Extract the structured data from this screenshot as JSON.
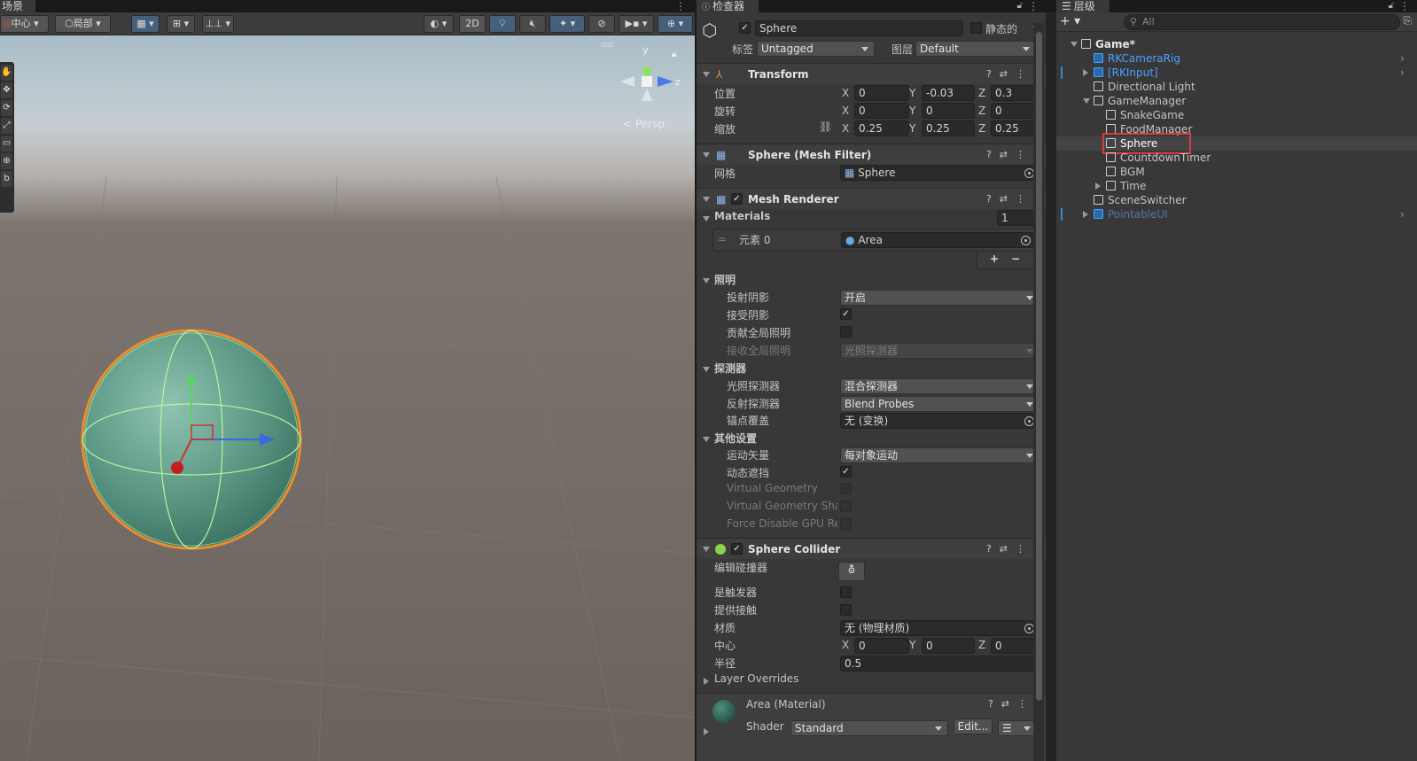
{
  "scene_panel": {
    "tab_label": "场景",
    "toolbar": {
      "pivot_label": "中心",
      "space_label": "局部",
      "mode_2d_label": "2D"
    },
    "tools": [
      "✋",
      "✥",
      "⟳",
      "⤢",
      "▭",
      "⊕",
      "b"
    ],
    "gizmo": {
      "y_label": "y",
      "x_label": "x",
      "z_label": "z",
      "persp_label": "< Persp"
    }
  },
  "inspector": {
    "tab_label": "检查器",
    "object": {
      "enabled": true,
      "name": "Sphere",
      "static_label": "静态的",
      "tag_label": "标签",
      "tag_value": "Untagged",
      "layer_label": "图层",
      "layer_value": "Default"
    },
    "transform": {
      "title": "Transform",
      "position_label": "位置",
      "rotation_label": "旋转",
      "scale_label": "缩放",
      "position": {
        "x": "0",
        "y": "-0.03",
        "z": "0.3"
      },
      "rotation": {
        "x": "0",
        "y": "0",
        "z": "0"
      },
      "scale": {
        "x": "0.25",
        "y": "0.25",
        "z": "0.25"
      }
    },
    "mesh_filter": {
      "title": "Sphere (Mesh Filter)",
      "mesh_label": "网格",
      "mesh_value": "Sphere"
    },
    "mesh_renderer": {
      "title": "Mesh Renderer",
      "materials_label": "Materials",
      "materials_count": "1",
      "element_label": "元素 0",
      "element_value": "Area",
      "lighting_label": "照明",
      "cast_shadows_label": "投射阴影",
      "cast_shadows_value": "开启",
      "receive_shadows_label": "接受阴影",
      "contribute_gi_label": "贡献全局照明",
      "receive_gi_label": "接收全局照明",
      "receive_gi_value": "光照探测器",
      "probes_label": "探测器",
      "light_probes_label": "光照探测器",
      "light_probes_value": "混合探测器",
      "reflection_probes_label": "反射探测器",
      "reflection_probes_value": "Blend Probes",
      "anchor_override_label": "锚点覆盖",
      "anchor_override_value": "无 (变换)",
      "additional_label": "其他设置",
      "motion_vectors_label": "运动矢量",
      "motion_vectors_value": "每对象运动",
      "dynamic_occlusion_label": "动态遮挡",
      "virtual_geometry_label": "Virtual Geometry",
      "virtual_geometry_shadows_label": "Virtual Geometry Sha",
      "force_disable_gpu_label": "Force Disable GPU Re"
    },
    "sphere_collider": {
      "title": "Sphere Collider",
      "edit_collider_label": "编辑碰撞器",
      "is_trigger_label": "是触发器",
      "provides_contacts_label": "提供接触",
      "material_label": "材质",
      "material_value": "无 (物理材质)",
      "center_label": "中心",
      "center": {
        "x": "0",
        "y": "0",
        "z": "0"
      },
      "radius_label": "半径",
      "radius_value": "0.5",
      "layer_overrides_label": "Layer Overrides"
    },
    "material": {
      "name": "Area (Material)",
      "shader_label": "Shader",
      "shader_value": "Standard",
      "edit_label": "Edit..."
    }
  },
  "hierarchy": {
    "tab_label": "层级",
    "search_placeholder": "All",
    "items": [
      {
        "label": "Game*",
        "depth": 0,
        "expanded": true,
        "bold": true,
        "style": "scene"
      },
      {
        "label": "RKCameraRig",
        "depth": 1,
        "style": "prefab"
      },
      {
        "label": "[RKInput]",
        "depth": 1,
        "style": "prefab",
        "collapsed": true
      },
      {
        "label": "Directional Light",
        "depth": 1
      },
      {
        "label": "GameManager",
        "depth": 1,
        "expanded": true
      },
      {
        "label": "SnakeGame",
        "depth": 2
      },
      {
        "label": "FoodManager",
        "depth": 2
      },
      {
        "label": "Sphere",
        "depth": 2,
        "selected": true
      },
      {
        "label": "CountdownTimer",
        "depth": 2
      },
      {
        "label": "BGM",
        "depth": 2
      },
      {
        "label": "Time",
        "depth": 2,
        "collapsed": true
      },
      {
        "label": "SceneSwitcher",
        "depth": 1
      },
      {
        "label": "PointableUI",
        "depth": 1,
        "style": "prefab-dim",
        "collapsed": true
      }
    ]
  },
  "colors": {
    "selection_highlight": "#e0393d",
    "sphere_outline": "#f08a2a",
    "prefab_blue": "#4aa0ff"
  }
}
